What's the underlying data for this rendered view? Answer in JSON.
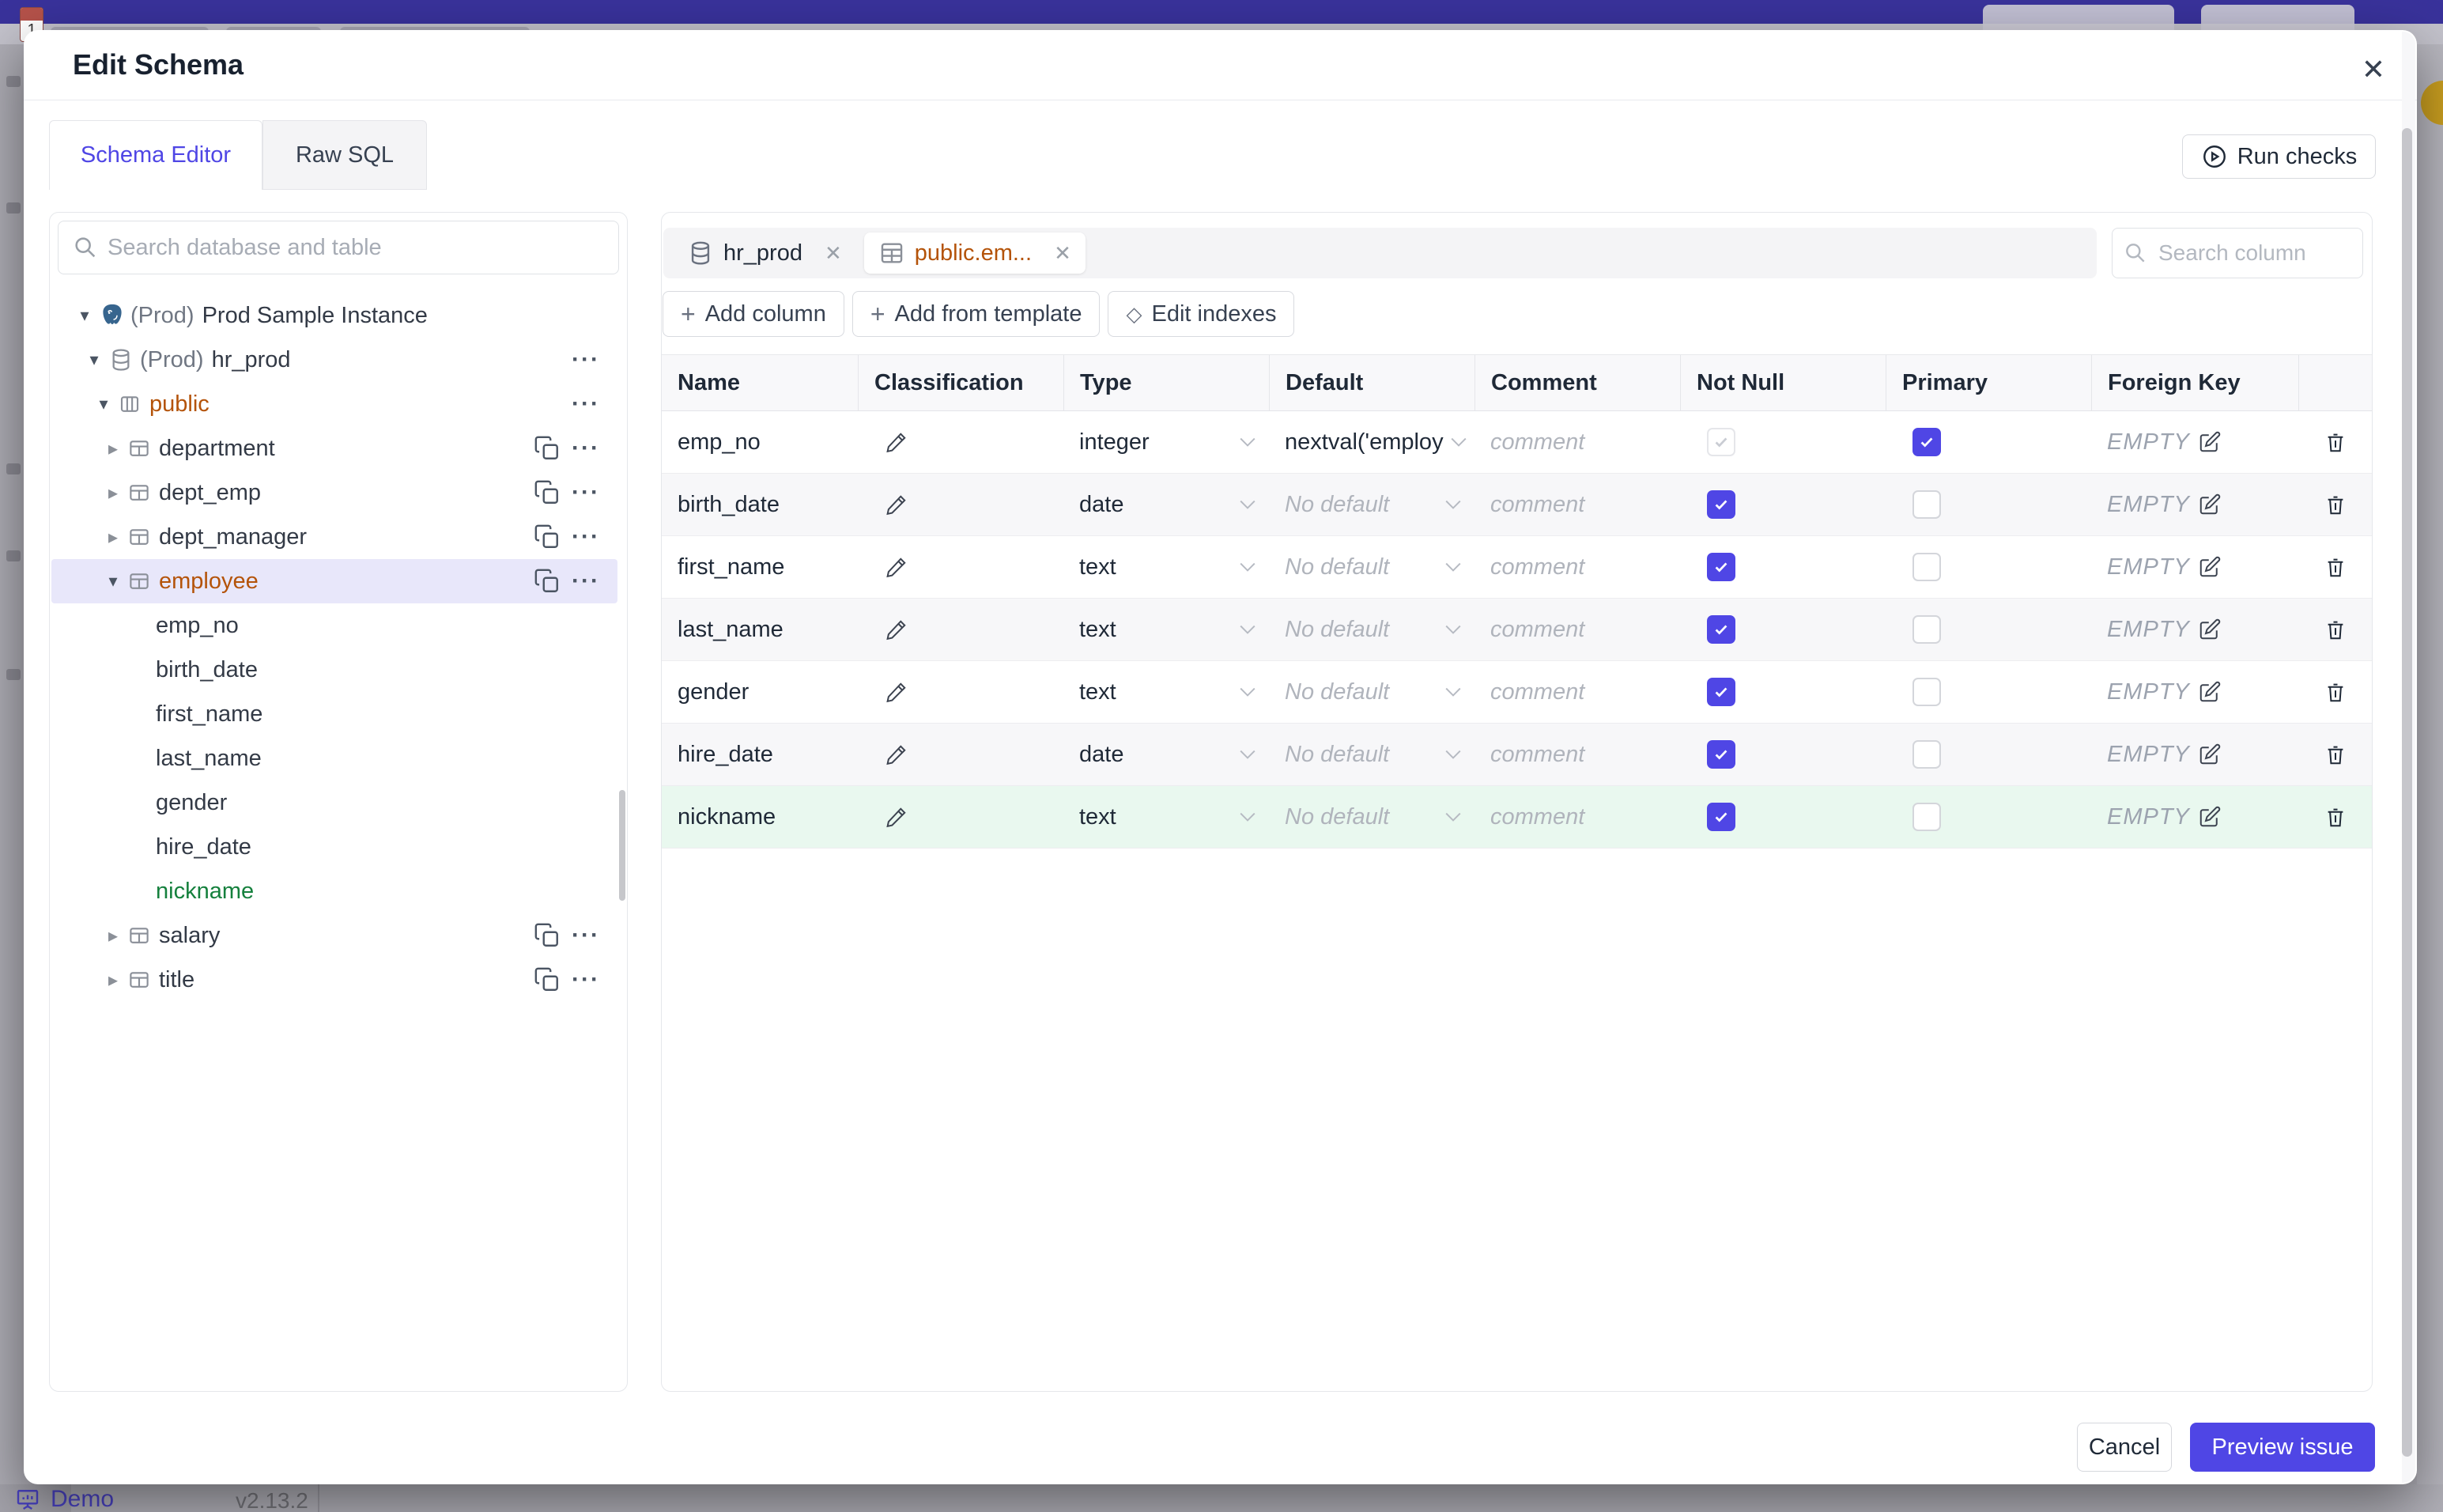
{
  "colors": {
    "accent": "#4f46e5",
    "header_indigo": "#39329b",
    "selected_tree_bg": "#e8e7fa",
    "new_row_bg": "#e9f8ef",
    "amber_text": "#b45309",
    "green_text": "#15803d",
    "zebra_row_bg": "#f7f7f9"
  },
  "icons": {
    "caret_down": "▾",
    "caret_right": "▸",
    "more": "···",
    "close": "✕",
    "plus": "+",
    "diamond": "◇"
  },
  "background": {
    "favicon_number": "1",
    "demo_label": "Demo",
    "version": "v2.13.2"
  },
  "modal": {
    "title": "Edit Schema",
    "run_checks": "Run checks",
    "tabs": [
      {
        "label": "Schema Editor"
      },
      {
        "label": "Raw SQL"
      }
    ],
    "sidebar": {
      "search_placeholder": "Search database and table",
      "instance_prefix": "(Prod)",
      "instance_name": "Prod Sample Instance",
      "db_prefix": "(Prod)",
      "db_name": "hr_prod",
      "schema_name": "public",
      "tables_before": [
        "department",
        "dept_emp",
        "dept_manager"
      ],
      "selected_table": "employee",
      "columns": [
        "emp_no",
        "birth_date",
        "first_name",
        "last_name",
        "gender",
        "hire_date"
      ],
      "new_column": "nickname",
      "tables_after": [
        "salary",
        "title"
      ]
    },
    "main": {
      "chips": [
        {
          "label": "hr_prod"
        },
        {
          "label": "public.em..."
        }
      ],
      "search_placeholder": "Search column",
      "toolbar": {
        "add_column": "Add column",
        "add_from_template": "Add from template",
        "edit_indexes": "Edit indexes"
      },
      "table": {
        "headers": [
          "Name",
          "Classification",
          "Type",
          "Default",
          "Comment",
          "Not Null",
          "Primary",
          "Foreign Key"
        ],
        "comment_placeholder": "comment",
        "fk_empty": "EMPTY",
        "rows": [
          {
            "name": "emp_no",
            "type": "integer",
            "default": "nextval('employ",
            "not_null": "checked-disabled",
            "primary": true,
            "new": false
          },
          {
            "name": "birth_date",
            "type": "date",
            "default": "No default",
            "not_null": "checked",
            "primary": false,
            "new": false
          },
          {
            "name": "first_name",
            "type": "text",
            "default": "No default",
            "not_null": "checked",
            "primary": false,
            "new": false
          },
          {
            "name": "last_name",
            "type": "text",
            "default": "No default",
            "not_null": "checked",
            "primary": false,
            "new": false
          },
          {
            "name": "gender",
            "type": "text",
            "default": "No default",
            "not_null": "checked",
            "primary": false,
            "new": false
          },
          {
            "name": "hire_date",
            "type": "date",
            "default": "No default",
            "not_null": "checked",
            "primary": false,
            "new": false
          },
          {
            "name": "nickname",
            "type": "text",
            "default": "No default",
            "not_null": "checked",
            "primary": false,
            "new": true
          }
        ]
      }
    },
    "footer": {
      "cancel": "Cancel",
      "primary": "Preview issue"
    }
  }
}
